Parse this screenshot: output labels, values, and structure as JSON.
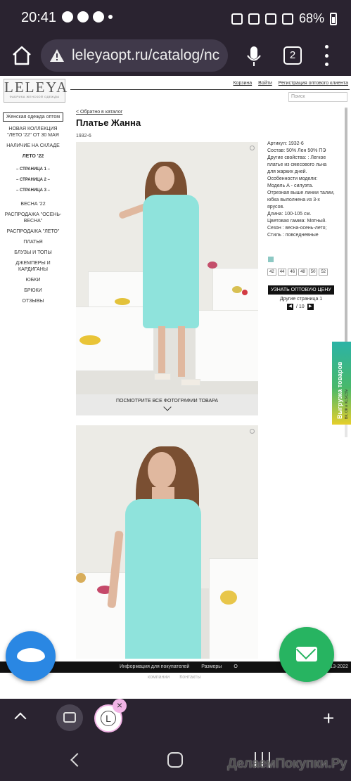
{
  "status_bar": {
    "time": "20:41",
    "battery": "68%"
  },
  "browser": {
    "url": "leleyaopt.ru/catalog/nc",
    "tab_count": "2"
  },
  "site": {
    "logo_name": "LELEYA",
    "logo_sub": "ФАБРИКА ЖЕНСКОЙ ОДЕЖДЫ",
    "top_links": [
      "Корзина",
      "Войти",
      "Регистрация оптового клиента"
    ],
    "search_placeholder": "Поиск",
    "category_box": "Женская одежда оптом",
    "menu": [
      "НОВАЯ КОЛЛЕКЦИЯ \"ЛЕТО '22\" ОТ 30 МАЯ",
      "НАЛИЧИЕ НА СКЛАДЕ",
      "ЛЕТО '22",
      "– СТРАНИЦА 1 –",
      "– СТРАНИЦА 2 –",
      "– СТРАНИЦА 3 –",
      "ВЕСНА '22",
      "РАСПРОДАЖА \"ОСЕНЬ-ВЕСНА\"",
      "РАСПРОДАЖА \"ЛЕТО\"",
      "ПЛАТЬЯ",
      "БЛУЗЫ И ТОПЫ",
      "ДЖЕМПЕРЫ И КАРДИГАНЫ",
      "ЮБКИ",
      "БРЮКИ",
      "ОТЗЫВЫ"
    ]
  },
  "product": {
    "back_link": "< Обратно в каталог",
    "title": "Платье Жанна",
    "code": "1932-6",
    "photo_caption": "ПОСМОТРИТЕ ВСЕ ФОТОГРАФИИ ТОВАРА",
    "details": [
      "Артикул: 1932-6",
      "Состав: 50% Лен 50% ПЭ",
      "Другие свойства: : Легкое платье из смесового льна для жарких дней.",
      "Особенности модели: Модель А - силуэта. Отрезная выше линии талии, юбка выполнена из 3-х ярусов.",
      "Длина: 100-105 см.",
      "Цветовая гамма: Мятный.",
      "Сезон : весна-осень-лето;",
      "Стиль : повседневные"
    ],
    "swatch_color": "#8dc9c4",
    "sizes": [
      "42",
      "44",
      "46",
      "48",
      "50",
      "52"
    ],
    "wholesale_button": "УЗНАТЬ ОПТОВУЮ ЦЕНУ",
    "other_page": "Другие страница 1",
    "pager_text": "/ 10"
  },
  "export_tab": {
    "title": "Выгрузка товаров",
    "sub": "ВК, ОК и XLS/CSV"
  },
  "footer": {
    "links": [
      "Информация для покупателей",
      "Размеры",
      "О"
    ],
    "year": "13-2022",
    "links2": [
      "компании",
      "Контакты"
    ]
  },
  "watermark": "ДелаемПокупки.Ру",
  "colors": {
    "browser_bg": "#2a2330",
    "chat_fab": "#2a87e3",
    "mail_fab": "#27b461",
    "dress": "#8fe3dc"
  }
}
